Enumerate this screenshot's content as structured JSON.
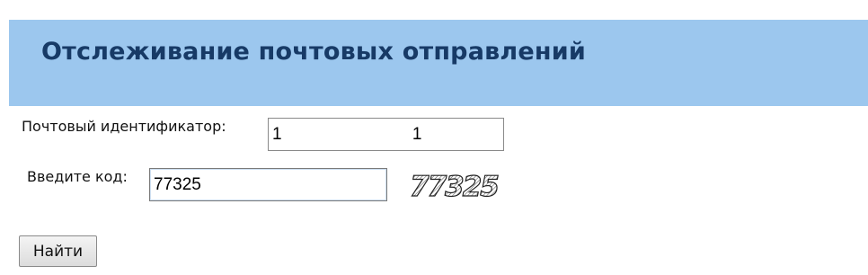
{
  "header": {
    "title": "Отслеживание почтовых отправлений"
  },
  "form": {
    "tracking_label": "Почтовый идентификатор:",
    "tracking_value": "1 1",
    "code_label": "Введите код:",
    "code_value": "77325",
    "captcha_text": "77325",
    "submit_label": "Найти"
  },
  "colors": {
    "header_background": "#9cc7ee",
    "header_text": "#173a66"
  }
}
